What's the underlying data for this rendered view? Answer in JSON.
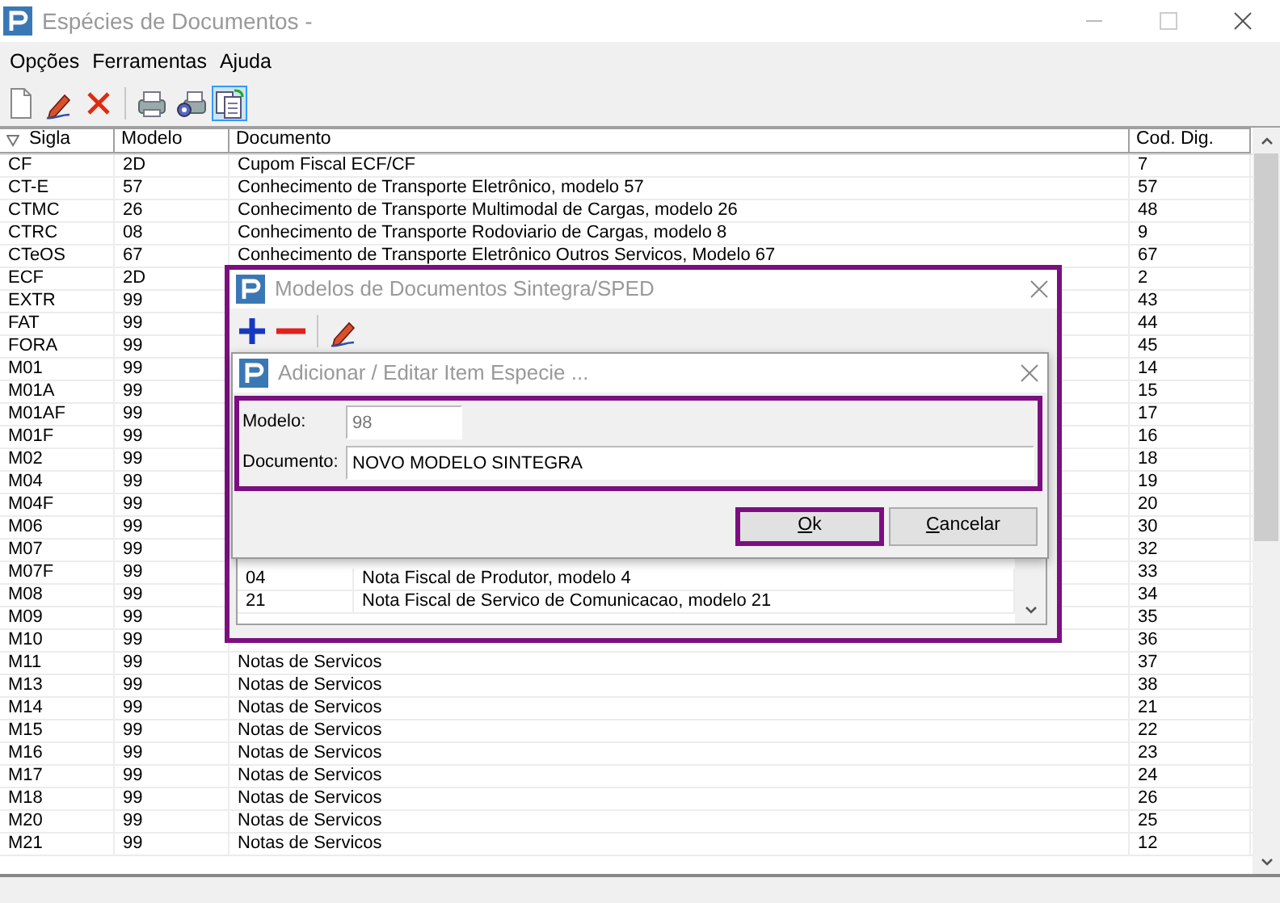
{
  "window": {
    "title": "Espécies de Documentos -"
  },
  "menu": [
    "Opções",
    "Ferramentas",
    "Ajuda"
  ],
  "toolbar": [
    {
      "kind": "new",
      "selected": false
    },
    {
      "kind": "edit",
      "selected": false
    },
    {
      "kind": "delete",
      "selected": false
    },
    {
      "kind": "separator"
    },
    {
      "kind": "print",
      "selected": false
    },
    {
      "kind": "print-setup",
      "selected": false
    },
    {
      "kind": "export",
      "selected": true
    }
  ],
  "table": {
    "columns": [
      {
        "label": "Sigla",
        "sorted": true
      },
      {
        "label": "Modelo",
        "sorted": false
      },
      {
        "label": "Documento",
        "sorted": false
      },
      {
        "label": "Cod. Dig.",
        "sorted": false
      }
    ],
    "rows": [
      {
        "sigla": "CF",
        "modelo": "2D",
        "documento": "Cupom Fiscal ECF/CF",
        "cod_dig": "7"
      },
      {
        "sigla": "CT-E",
        "modelo": "57",
        "documento": "Conhecimento de Transporte Eletrônico, modelo 57",
        "cod_dig": "57"
      },
      {
        "sigla": "CTMC",
        "modelo": "26",
        "documento": "Conhecimento de Transporte Multimodal de Cargas, modelo 26",
        "cod_dig": "48"
      },
      {
        "sigla": "CTRC",
        "modelo": "08",
        "documento": "Conhecimento de Transporte Rodoviario de Cargas, modelo 8",
        "cod_dig": "9"
      },
      {
        "sigla": "CTeOS",
        "modelo": "67",
        "documento": "Conhecimento de Transporte Eletrônico Outros Servicos, Modelo 67",
        "cod_dig": "67"
      },
      {
        "sigla": "ECF",
        "modelo": "2D",
        "cod_dig": "2"
      },
      {
        "sigla": "EXTR",
        "modelo": "99",
        "cod_dig": "43"
      },
      {
        "sigla": "FAT",
        "modelo": "99",
        "cod_dig": "44"
      },
      {
        "sigla": "FORA",
        "modelo": "99",
        "cod_dig": "45"
      },
      {
        "sigla": "M01",
        "modelo": "99",
        "cod_dig": "14"
      },
      {
        "sigla": "M01A",
        "modelo": "99",
        "cod_dig": "15"
      },
      {
        "sigla": "M01AF",
        "modelo": "99",
        "cod_dig": "17"
      },
      {
        "sigla": "M01F",
        "modelo": "99",
        "cod_dig": "16"
      },
      {
        "sigla": "M02",
        "modelo": "99",
        "cod_dig": "18"
      },
      {
        "sigla": "M04",
        "modelo": "99",
        "cod_dig": "19"
      },
      {
        "sigla": "M04F",
        "modelo": "99",
        "cod_dig": "20"
      },
      {
        "sigla": "M06",
        "modelo": "99",
        "cod_dig": "30"
      },
      {
        "sigla": "M07",
        "modelo": "99",
        "cod_dig": "32"
      },
      {
        "sigla": "M07F",
        "modelo": "99",
        "cod_dig": "33"
      },
      {
        "sigla": "M08",
        "modelo": "99",
        "cod_dig": "34"
      },
      {
        "sigla": "M09",
        "modelo": "99",
        "cod_dig": "35"
      },
      {
        "sigla": "M10",
        "modelo": "99",
        "cod_dig": "36"
      },
      {
        "sigla": "M11",
        "modelo": "99",
        "documento": "Notas de Servicos",
        "cod_dig": "37"
      },
      {
        "sigla": "M13",
        "modelo": "99",
        "documento": "Notas de Servicos",
        "cod_dig": "38"
      },
      {
        "sigla": "M14",
        "modelo": "99",
        "documento": "Notas de Servicos",
        "cod_dig": "21"
      },
      {
        "sigla": "M15",
        "modelo": "99",
        "documento": "Notas de Servicos",
        "cod_dig": "22"
      },
      {
        "sigla": "M16",
        "modelo": "99",
        "documento": "Notas de Servicos",
        "cod_dig": "23"
      },
      {
        "sigla": "M17",
        "modelo": "99",
        "documento": "Notas de Servicos",
        "cod_dig": "24"
      },
      {
        "sigla": "M18",
        "modelo": "99",
        "documento": "Notas de Servicos",
        "cod_dig": "26"
      },
      {
        "sigla": "M20",
        "modelo": "99",
        "documento": "Notas de Servicos",
        "cod_dig": "25"
      },
      {
        "sigla": "M21",
        "modelo": "99",
        "documento": "Notas de Servicos",
        "cod_dig": "12"
      }
    ]
  },
  "models_dialog": {
    "title": "Modelos de Documentos Sintegra/SPED",
    "toolbar": [
      {
        "kind": "add"
      },
      {
        "kind": "remove"
      },
      {
        "kind": "separator"
      },
      {
        "kind": "edit"
      }
    ],
    "rows": [
      {
        "code": "04",
        "description": "Nota Fiscal de Produtor, modelo 4"
      },
      {
        "code": "21",
        "description": "Nota Fiscal de Servico de Comunicacao, modelo 21"
      }
    ]
  },
  "edit_dialog": {
    "title": "Adicionar / Editar Item Especie ...",
    "fields_highlighted": true,
    "fields": [
      {
        "label": "Modelo:",
        "value": "98",
        "disabled": true
      },
      {
        "label": "Documento:",
        "value": "NOVO MODELO SINTEGRA",
        "disabled": false
      }
    ],
    "buttons": [
      {
        "label": "Ok",
        "highlighted": true
      },
      {
        "label": "Cancelar",
        "highlighted": false
      }
    ]
  }
}
